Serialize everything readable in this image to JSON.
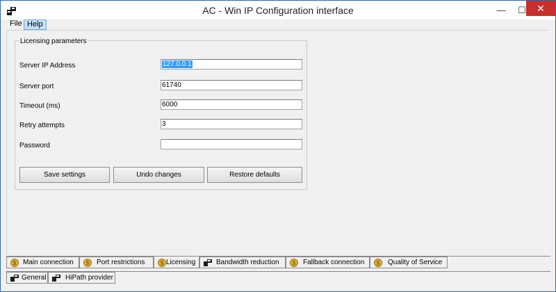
{
  "window": {
    "title": "AC - Win IP Configuration interface",
    "minimize_glyph": "—",
    "maximize_glyph": "☐",
    "close_glyph": "✕"
  },
  "menu": {
    "file": "File",
    "help": "Help"
  },
  "licensing": {
    "group_title": "Licensing parameters",
    "fields": [
      {
        "label": "Server IP Address",
        "value": "127.0.0.1",
        "selected": true
      },
      {
        "label": "Server port",
        "value": "61740"
      },
      {
        "label": "Timeout (ms)",
        "value": "6000"
      },
      {
        "label": "Retry attempts",
        "value": "3"
      },
      {
        "label": "Password",
        "value": ""
      }
    ],
    "buttons": {
      "save": "Save settings",
      "undo": "Undo changes",
      "restore": "Restore defaults"
    }
  },
  "tabs_row1": [
    {
      "label": "Main connection",
      "icon": "coin-icon"
    },
    {
      "label": "Port restrictions",
      "icon": "coin-icon"
    },
    {
      "label": "Licensing",
      "icon": "coin-icon",
      "active": true
    },
    {
      "label": "Bandwidth reduction",
      "icon": "network-icon"
    },
    {
      "label": "Fallback connection",
      "icon": "coin-icon"
    },
    {
      "label": "Quality of Service",
      "icon": "coin-icon"
    }
  ],
  "tabs_row2": [
    {
      "label": "General",
      "icon": "network-icon"
    },
    {
      "label": "HiPath provider",
      "icon": "network-icon"
    }
  ],
  "colors": {
    "selection": "#3399ff",
    "close_button": "#c7302b",
    "window_border": "#2a66b4",
    "coin": "#e0b030"
  }
}
